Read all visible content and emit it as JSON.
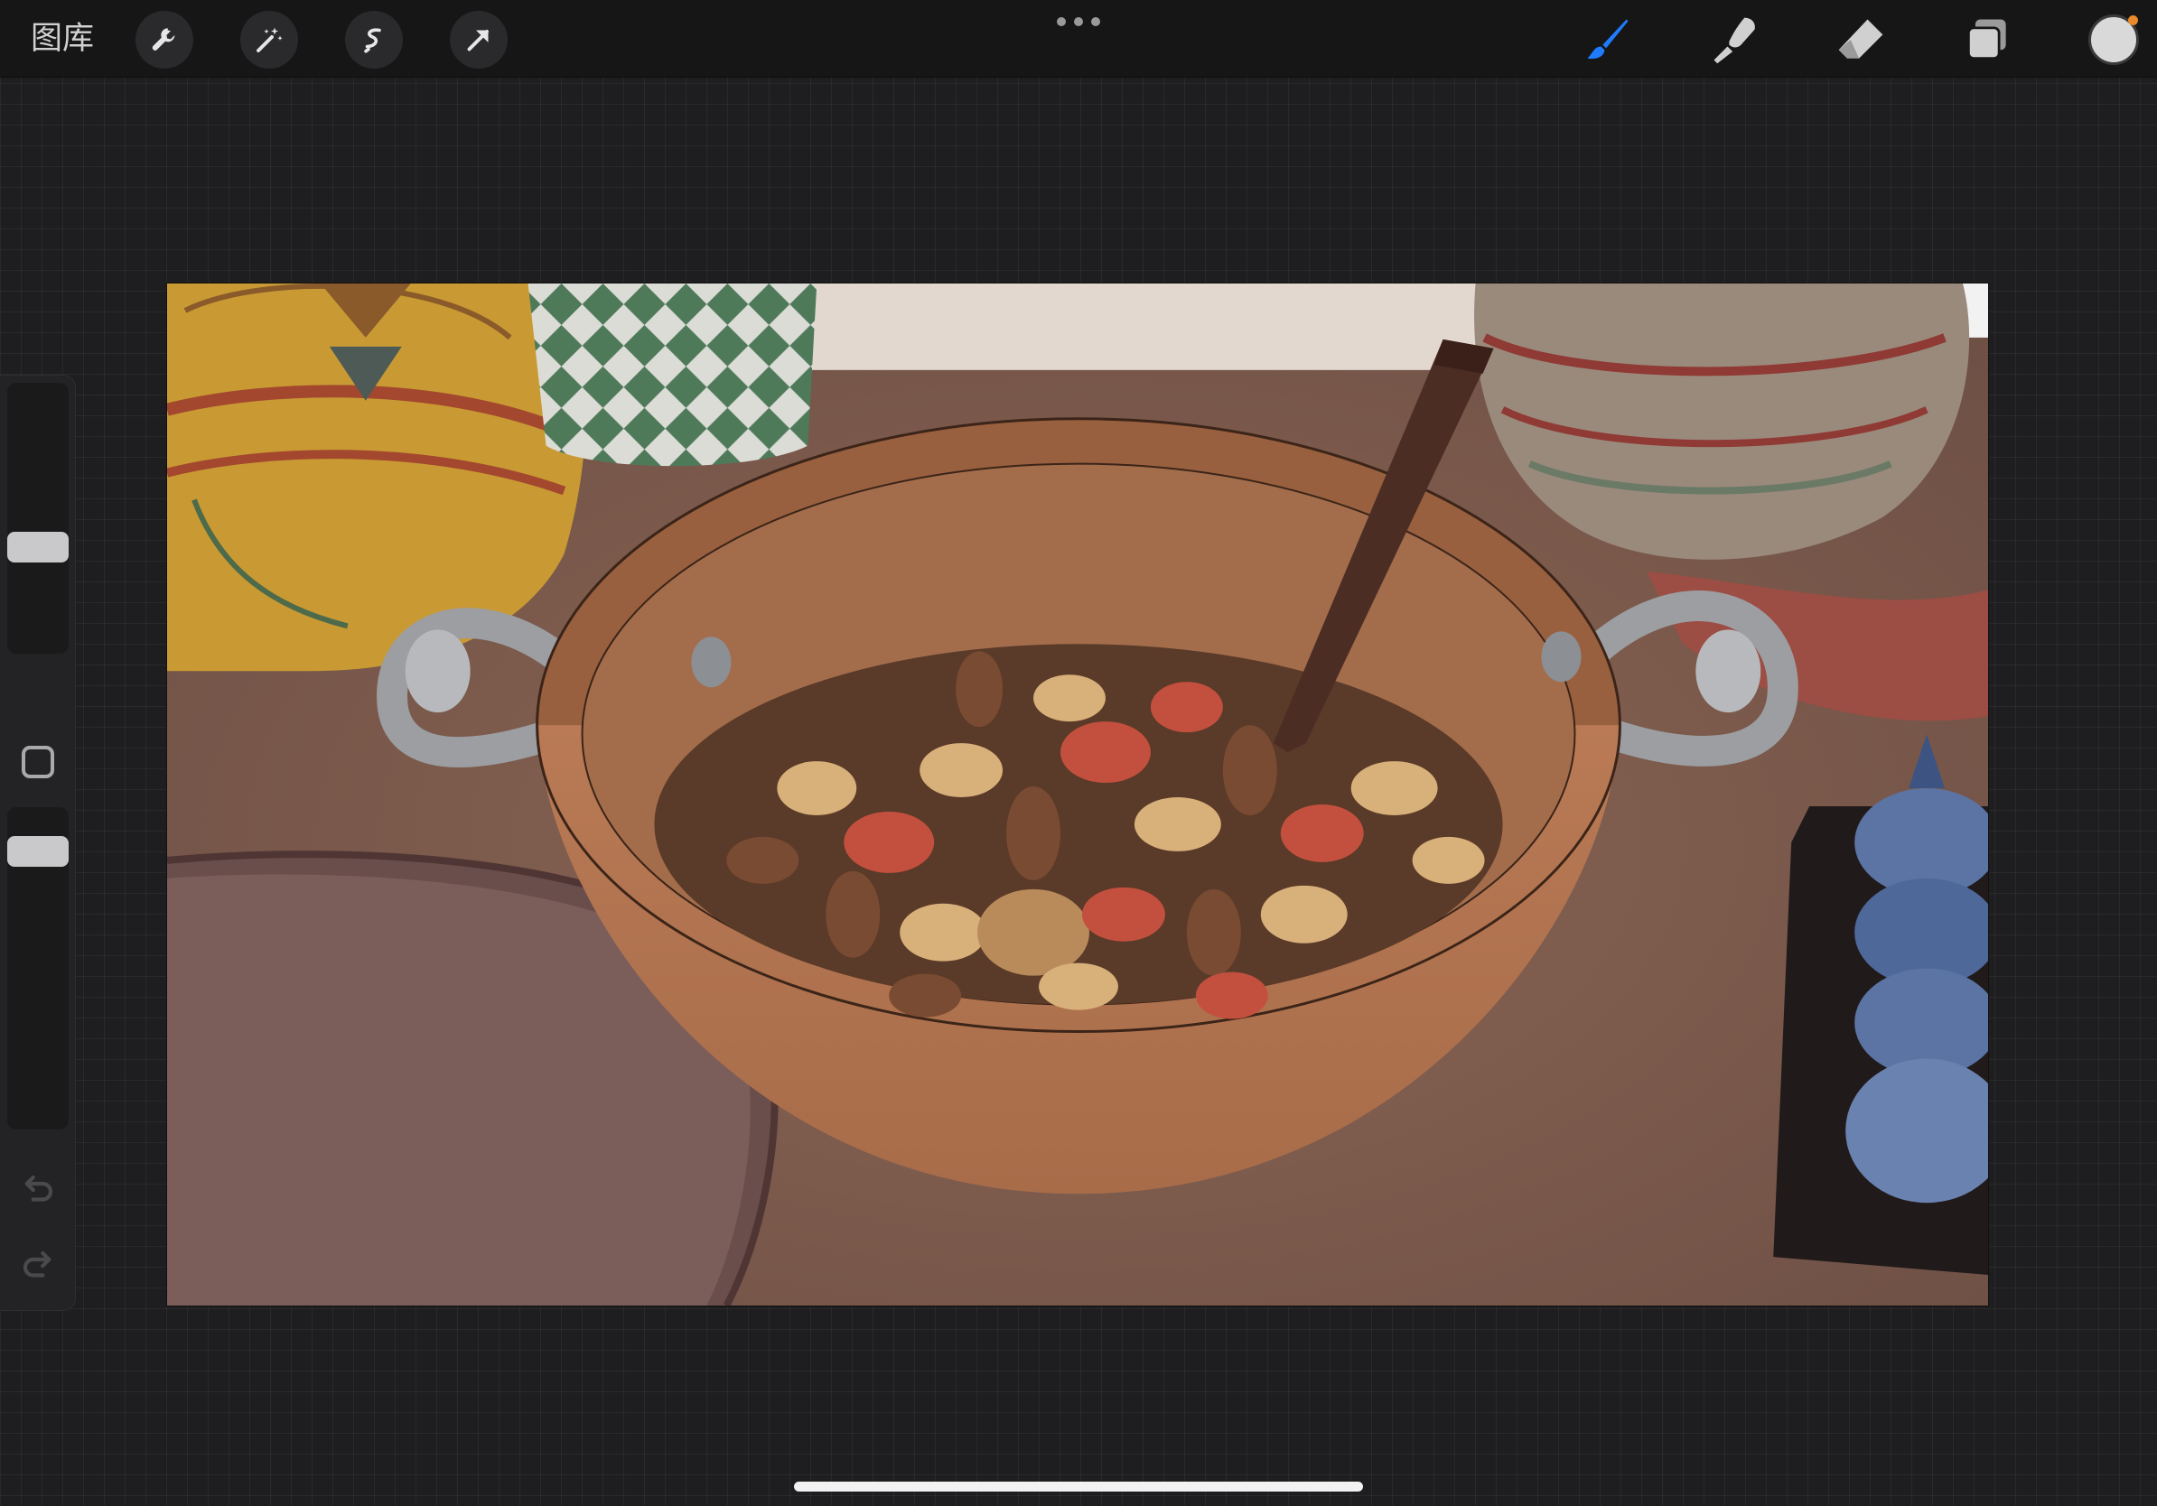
{
  "app": {
    "gallery_label": "图库"
  },
  "toolbar": {
    "actions": [
      {
        "icon": "wrench-icon"
      },
      {
        "icon": "magic-wand-icon"
      },
      {
        "icon": "selection-icon"
      },
      {
        "icon": "transform-arrow-icon"
      }
    ],
    "menu_icon": "more-dots-icon",
    "tools": [
      {
        "icon": "brush-icon",
        "active": true
      },
      {
        "icon": "smudge-icon",
        "active": false
      },
      {
        "icon": "eraser-icon",
        "active": false
      },
      {
        "icon": "layers-icon",
        "active": false
      }
    ],
    "current_color": "#d9d9d9",
    "color_indicator": "#e8892c",
    "active_tool_color": "#1f7cff",
    "inactive_tool_color": "#d0d0d0"
  },
  "sidebar": {
    "brush_size_level": 0.38,
    "opacity_level": 0.9,
    "modify_icon": "square-modify-icon",
    "undo_icon": "undo-icon",
    "redo_icon": "redo-icon"
  },
  "canvas": {
    "artwork": "nut-bowl-illustration"
  }
}
